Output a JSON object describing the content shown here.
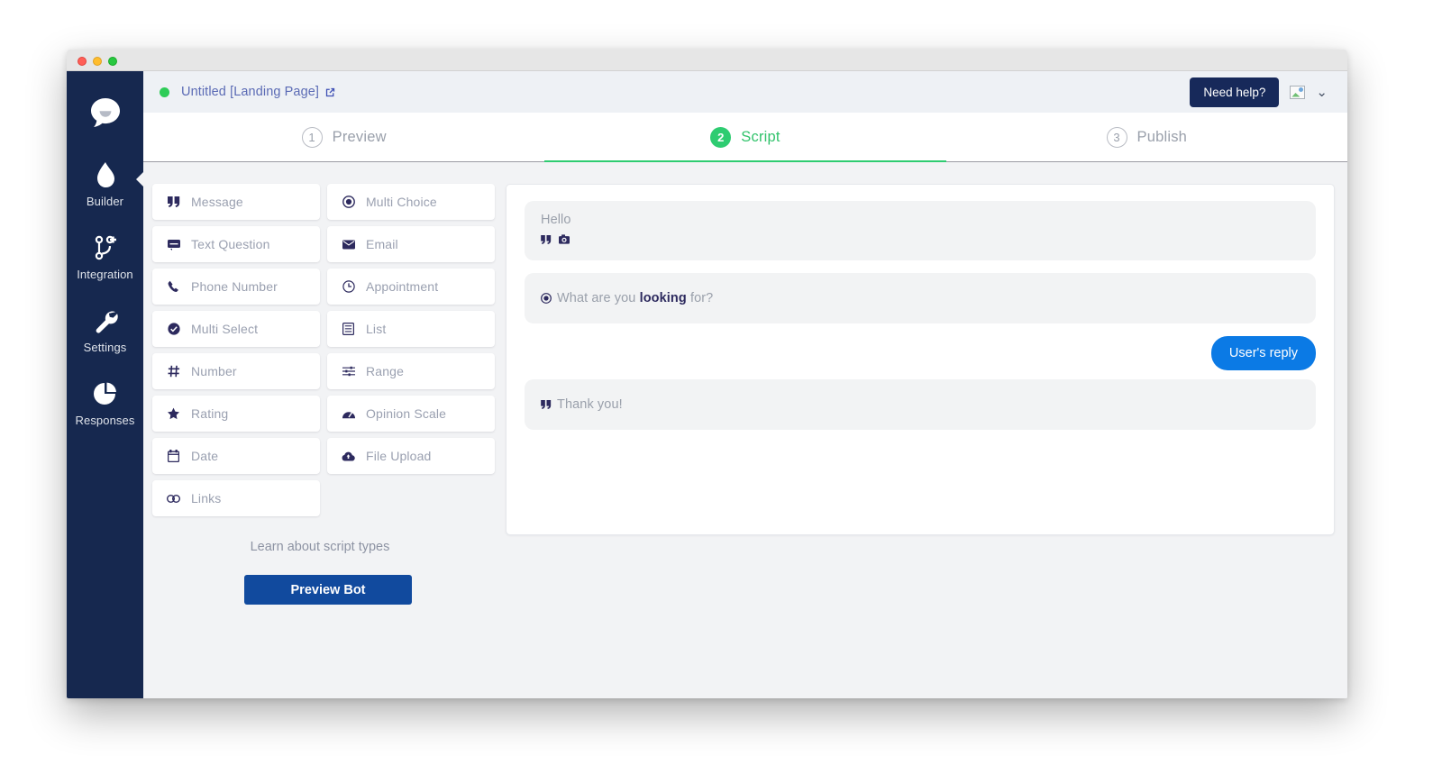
{
  "window": {
    "traffic_lights": [
      "close",
      "minimize",
      "maximize"
    ]
  },
  "header": {
    "status": "online",
    "title": "Untitled [Landing Page]",
    "external_link_icon": "external-link-icon",
    "need_help_label": "Need help?",
    "avatar_icon": "broken-image-icon",
    "chevron": "⌄"
  },
  "sidebar": {
    "logo_icon": "chat-bubble-logo-icon",
    "items": [
      {
        "label": "Builder",
        "icon": "flame-icon",
        "active": true
      },
      {
        "label": "Integration",
        "icon": "integration-branch-icon",
        "active": false
      },
      {
        "label": "Settings",
        "icon": "wrench-icon",
        "active": false
      },
      {
        "label": "Responses",
        "icon": "pie-chart-icon",
        "active": false
      }
    ]
  },
  "tabs": [
    {
      "number": "1",
      "label": "Preview",
      "active": false
    },
    {
      "number": "2",
      "label": "Script",
      "active": true
    },
    {
      "number": "3",
      "label": "Publish",
      "active": false
    }
  ],
  "palette": {
    "types": [
      {
        "label": "Message",
        "icon": "quote-icon"
      },
      {
        "label": "Multi Choice",
        "icon": "radio-button-icon"
      },
      {
        "label": "Text Question",
        "icon": "text-box-icon"
      },
      {
        "label": "Email",
        "icon": "envelope-icon"
      },
      {
        "label": "Phone Number",
        "icon": "phone-icon"
      },
      {
        "label": "Appointment",
        "icon": "clock-icon"
      },
      {
        "label": "Multi Select",
        "icon": "check-circle-icon"
      },
      {
        "label": "List",
        "icon": "list-icon"
      },
      {
        "label": "Number",
        "icon": "hash-icon"
      },
      {
        "label": "Range",
        "icon": "sliders-icon"
      },
      {
        "label": "Rating",
        "icon": "star-icon"
      },
      {
        "label": "Opinion Scale",
        "icon": "meter-icon"
      },
      {
        "label": "Date",
        "icon": "calendar-icon"
      },
      {
        "label": "File Upload",
        "icon": "cloud-upload-icon"
      },
      {
        "label": "Links",
        "icon": "link-icon"
      }
    ],
    "learn_link": "Learn about script types",
    "preview_button": "Preview Bot"
  },
  "script": {
    "steps": [
      {
        "kind": "message",
        "text": "Hello",
        "icons": [
          "quote-icon",
          "camera-icon"
        ]
      },
      {
        "kind": "multi-choice",
        "icon": "radio-button-icon",
        "text_prefix": "What are you ",
        "text_bold": "looking",
        "text_suffix": " for?"
      },
      {
        "kind": "user-reply",
        "text": "User's reply"
      },
      {
        "kind": "message",
        "icon": "quote-icon",
        "text": "Thank you!"
      }
    ]
  },
  "colors": {
    "sidebar_bg": "#16284f",
    "accent_green": "#2ecc71",
    "reply_blue": "#0b7ae5",
    "primary_button": "#114a9e",
    "need_help_bg": "#17295a",
    "title_link": "#5b6bb5",
    "icon_navy": "#2d2a5e",
    "muted_text": "#9aa0ab"
  }
}
